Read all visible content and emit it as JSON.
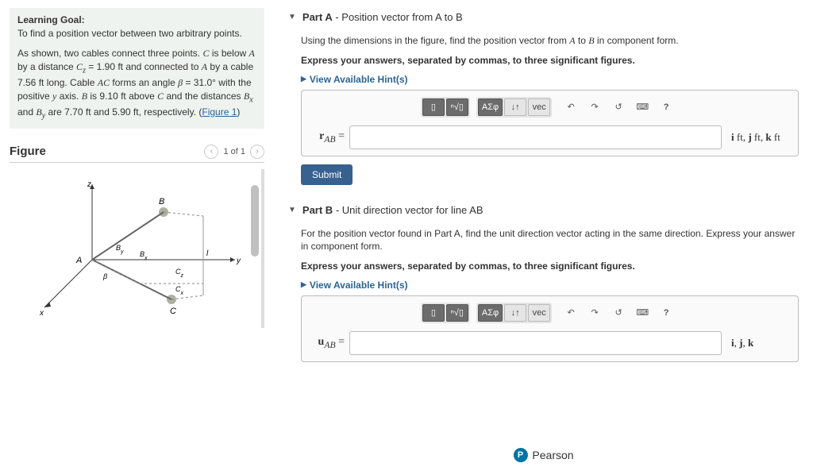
{
  "goal": {
    "label": "Learning Goal:",
    "text": "To find a position vector between two arbitrary points.",
    "para_html": "As shown, two cables connect three points. <i class='var'>C</i> is below <i class='var'>A</i> by a distance <i class='var'>C<sub>z</sub></i> = 1.90 ft and connected to <i class='var'>A</i> by a cable 7.56 ft long. Cable <i class='var'>AC</i> forms an angle <i class='var'>β</i> = 31.0° with the positive <i class='var'>y</i> axis. <i class='var'>B</i> is 9.10 ft above <i class='var'>C</i> and the distances <i class='var'>B<sub>x</sub></i> and <i class='var'>B<sub>y</sub></i> are 7.70 ft and 5.90 ft, respectively. (",
    "fig_link": "Figure 1",
    "close": ")"
  },
  "figure": {
    "heading": "Figure",
    "page": "1 of 1"
  },
  "partA": {
    "title_strong": "Part A",
    "title_rest": " - Position vector from A to B",
    "line1_html": "Using the dimensions in the figure, find the position vector from <i class='var'>A</i> to <i class='var'>B</i> in component form.",
    "line2": "Express your answers, separated by commas, to three significant figures.",
    "hints": "View Available Hint(s)",
    "lhs_html": "<b>r</b><sub><i>AB</i></sub> =",
    "rhs_html": "<b>i</b> ft, <b>j</b> ft, <b>k</b> ft",
    "submit": "Submit"
  },
  "partB": {
    "title_strong": "Part B",
    "title_rest": " - Unit direction vector for line AB",
    "line1": "For the position vector found in Part A, find the unit direction vector acting in the same direction. Express your answer in component form.",
    "line2": "Express your answers, separated by commas, to three significant figures.",
    "hints": "View Available Hint(s)",
    "lhs_html": "<b>u</b><sub><i>AB</i></sub> =",
    "rhs_html": "<b>i</b>, <b>j</b>, <b>k</b>"
  },
  "toolbar": {
    "templates": "▯",
    "root": "ⁿ√▯",
    "greek": "ΑΣφ",
    "arrows": "↓↑",
    "vec": "vec",
    "undo": "↶",
    "redo": "↷",
    "reset": "↺",
    "keyboard": "⌨",
    "help": "?"
  },
  "footer": {
    "brand": "Pearson",
    "badge": "P"
  }
}
